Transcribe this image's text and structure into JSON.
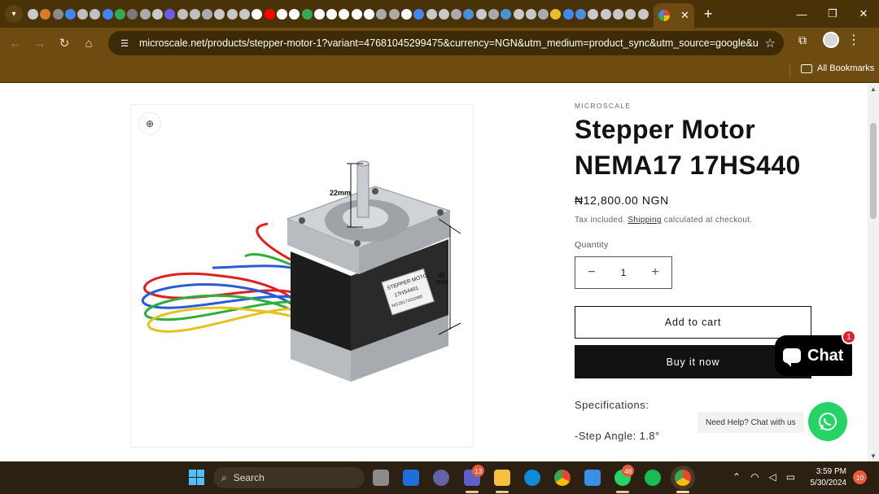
{
  "browser": {
    "tab_close_glyph": "✕",
    "new_tab_glyph": "+",
    "window": {
      "minimize": "—",
      "maximize": "❐",
      "close": "✕"
    },
    "url": "microscale.net/products/stepper-motor-1?variant=47681045299475&currency=NGN&utm_medium=product_sync&utm_source=google&utm_c...",
    "bookmarks_label": "All Bookmarks",
    "favicon_colors": [
      "#c8c8c8",
      "#d67b2f",
      "#8a8a8a",
      "#4285f4",
      "#bdbdbd",
      "#c0c0c0",
      "#4285f4",
      "#34a853",
      "#7a7a7a",
      "#aaaaaa",
      "#c8c8c8",
      "#6c5ce7",
      "#c0c0c0",
      "#c0c0c0",
      "#aaaaaa",
      "#c8c8c8",
      "#c8c8c8",
      "#c8c8c8",
      "#ffffff",
      "#ff0000",
      "#ffffff",
      "#ffffff",
      "#34a853",
      "#ffffff",
      "#ffffff",
      "#ffffff",
      "#ffffff",
      "#ffffff",
      "#aaaaaa",
      "#aaaaaa",
      "#ffffff",
      "#4285f4",
      "#c8c8c8",
      "#c8c8c8",
      "#aaaaaa",
      "#4a90d9",
      "#c8c8c8",
      "#aaaaaa",
      "#4a90d9",
      "#c8c8c8",
      "#c8c8c8",
      "#aaaaaa",
      "#e6c229",
      "#4285f4",
      "#4a90d9",
      "#c8c8c8",
      "#c8c8c8",
      "#c8c8c8",
      "#c8c8c8",
      "#c8c8c8"
    ]
  },
  "product": {
    "vendor": "MICROSCALE",
    "title": "Stepper Motor NEMA17 17HS440",
    "price": "₦12,800.00 NGN",
    "tax_prefix": "Tax included. ",
    "tax_link": "Shipping",
    "tax_suffix": " calculated at checkout.",
    "quantity_label": "Quantity",
    "quantity_value": "1",
    "minus": "−",
    "plus": "+",
    "add_to_cart": "Add to cart",
    "buy_now": "Buy it now",
    "spec_heading": "Specifications:",
    "spec_1": "-Step Angle: 1.8°",
    "image_labels": {
      "shaft": "22mm",
      "height_value": "40",
      "height_unit": "mm",
      "label_line1": "STEPPER MOTOR",
      "label_line2": "17HS4401",
      "label_line3": "NO:20171012480"
    }
  },
  "chat": {
    "label": "Chat",
    "badge": "1",
    "whatsapp_tip": "Need Help? Chat with us"
  },
  "taskbar": {
    "search": "Search",
    "badge_teams": "13",
    "badge_whatsapp": "46",
    "time": "3:59 PM",
    "date": "5/30/2024",
    "notifications": "10"
  }
}
